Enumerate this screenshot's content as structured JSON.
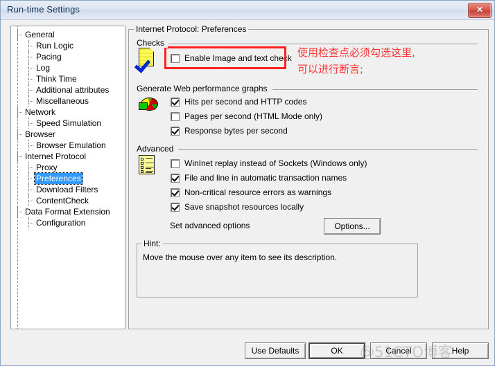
{
  "window": {
    "title": "Run-time Settings",
    "close_glyph": "✕",
    "close_label": "Close"
  },
  "tree": {
    "items": [
      {
        "label": "General",
        "level": 0,
        "selected": false
      },
      {
        "label": "Run Logic",
        "level": 1,
        "selected": false
      },
      {
        "label": "Pacing",
        "level": 1,
        "selected": false
      },
      {
        "label": "Log",
        "level": 1,
        "selected": false
      },
      {
        "label": "Think Time",
        "level": 1,
        "selected": false
      },
      {
        "label": "Additional attributes",
        "level": 1,
        "selected": false
      },
      {
        "label": "Miscellaneous",
        "level": 1,
        "selected": false
      },
      {
        "label": "Network",
        "level": 0,
        "selected": false
      },
      {
        "label": "Speed Simulation",
        "level": 1,
        "selected": false
      },
      {
        "label": "Browser",
        "level": 0,
        "selected": false
      },
      {
        "label": "Browser Emulation",
        "level": 1,
        "selected": false
      },
      {
        "label": "Internet Protocol",
        "level": 0,
        "selected": false
      },
      {
        "label": "Proxy",
        "level": 1,
        "selected": false
      },
      {
        "label": "Preferences",
        "level": 1,
        "selected": true
      },
      {
        "label": "Download Filters",
        "level": 1,
        "selected": false
      },
      {
        "label": "ContentCheck",
        "level": 1,
        "selected": false
      },
      {
        "label": "Data Format Extension",
        "level": 0,
        "selected": false
      },
      {
        "label": "Configuration",
        "level": 1,
        "selected": false
      }
    ]
  },
  "main": {
    "section_title": "Internet Protocol: Preferences",
    "checks": {
      "title": "Checks",
      "icon": "yellow-page-with-blue-check-icon",
      "checkbox": {
        "label": "Enable Image and text check",
        "accelerator": "E",
        "checked": false
      }
    },
    "graphs": {
      "title": "Generate Web performance graphs",
      "icon": "pie-chart-icon",
      "checkboxes": [
        {
          "label": "Hits per second and HTTP codes",
          "checked": true
        },
        {
          "label": "Pages per second (HTML Mode only)",
          "checked": false
        },
        {
          "label": "Response bytes per second",
          "checked": true
        }
      ]
    },
    "advanced": {
      "title": "Advanced",
      "icon": "yellow-list-document-icon",
      "checkboxes": [
        {
          "label": "WinInet replay instead of Sockets (Windows only)",
          "checked": false
        },
        {
          "label": "File and line in automatic transaction names",
          "checked": true
        },
        {
          "label": "Non-critical resource errors as warnings",
          "checked": true
        },
        {
          "label": "Save snapshot resources locally",
          "checked": true
        }
      ],
      "options_row_label": "Set advanced options",
      "options_button": "Options..."
    },
    "hint": {
      "title": "Hint:",
      "text": "Move the mouse over any item to see its description."
    }
  },
  "annotation": {
    "line1": "使用检查点必须勾选这里,",
    "line2": "可以进行断言;",
    "color": "#ff3333",
    "highlight_box_color": "#ff2020"
  },
  "footer": {
    "buttons": [
      {
        "label": "Use Defaults",
        "default": false
      },
      {
        "label": "OK",
        "default": true
      },
      {
        "label": "Cancel",
        "default": false
      },
      {
        "label": "Help",
        "default": false
      }
    ]
  },
  "watermark": "@51CTO博客"
}
